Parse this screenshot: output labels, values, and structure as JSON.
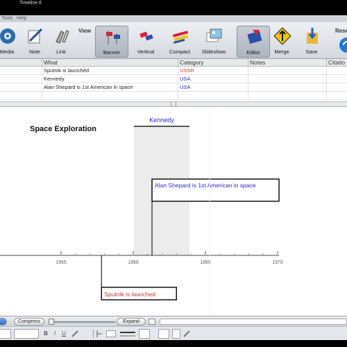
{
  "window": {
    "title": "Timeline.tl"
  },
  "menu": {
    "items": [
      "Tools",
      "Help"
    ]
  },
  "toolbar": {
    "view_label": "View",
    "reset_label": "Rese",
    "buttons": {
      "media": "Media",
      "note": "Note",
      "link": "Link",
      "banner": "Banner",
      "vertical": "Vertical",
      "compact": "Compact",
      "slideshow": "Slideshow",
      "editor": "Editor",
      "merge": "Merge",
      "save": "Save"
    }
  },
  "grid": {
    "columns": [
      "What",
      "Category",
      "Notes",
      "Citatio"
    ],
    "rows": [
      {
        "what": "Sputnik is launched",
        "category": "USSR",
        "category_color": "#c0392b"
      },
      {
        "what": "Kennedy",
        "category": "USA",
        "category_color": "#2a2ad0"
      },
      {
        "what": "Alan Shepard is 1st American in space",
        "category": "USA",
        "category_color": "#2a2ad0"
      }
    ]
  },
  "timeline": {
    "title": "Space Exploration",
    "axis_ticks": [
      "1955",
      "1960",
      "1965",
      "1970"
    ],
    "events": {
      "span": {
        "label": "Kennedy",
        "start": 1961.0,
        "end": 1963.9,
        "color": "#2a2ad0"
      },
      "upper": {
        "label": "Alan Shepard is 1st American in space",
        "year": 1961.3,
        "color": "#2a2ad0"
      },
      "lower": {
        "label": "Sputnik is launched",
        "year": 1957.8,
        "color": "#c0392b"
      }
    }
  },
  "bottombar": {
    "compress_label": "Compress",
    "expand_label": "Expand"
  },
  "formatbar": {
    "bold": "B",
    "italic": "I",
    "underline": "U"
  }
}
